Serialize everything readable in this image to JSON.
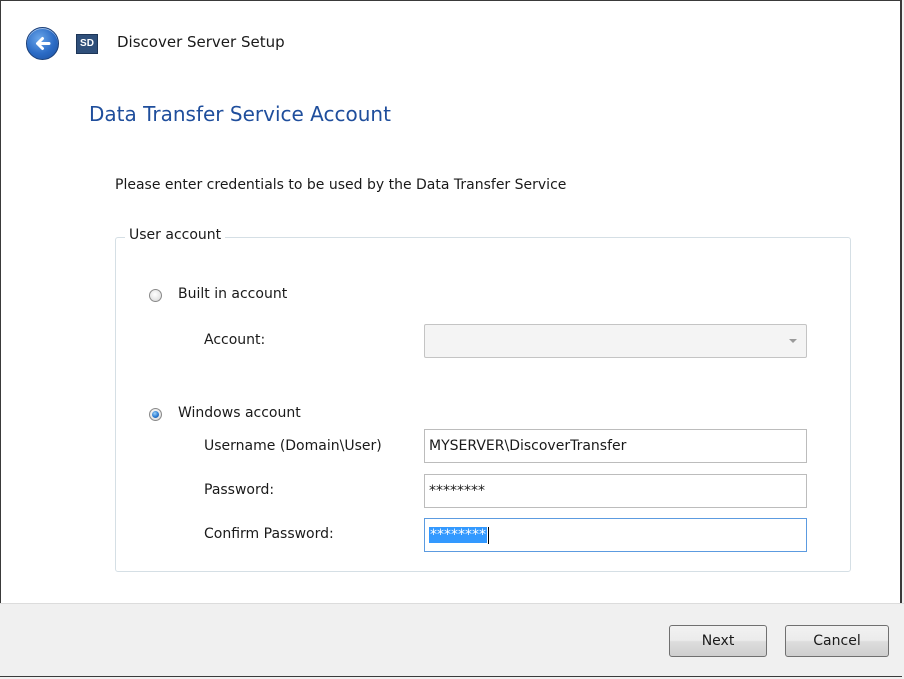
{
  "window": {
    "title": "Discover Server Setup",
    "app_icon_text": "SD"
  },
  "page": {
    "heading": "Data Transfer Service Account",
    "instructions": "Please enter credentials to be used by the Data Transfer Service"
  },
  "user_account_group": {
    "legend": "User account",
    "built_in": {
      "label": "Built in account",
      "selected": false,
      "account_label": "Account:",
      "account_value": ""
    },
    "windows": {
      "label": "Windows account",
      "selected": true,
      "username_label": "Username (Domain\\User)",
      "username_value": "MYSERVER\\DiscoverTransfer",
      "password_label": "Password:",
      "password_value": "********",
      "confirm_label": "Confirm Password:",
      "confirm_value": "********"
    }
  },
  "footer": {
    "next_label": "Next",
    "cancel_label": "Cancel"
  },
  "colors": {
    "heading": "#1f4e9c",
    "selection": "#3399ff"
  }
}
